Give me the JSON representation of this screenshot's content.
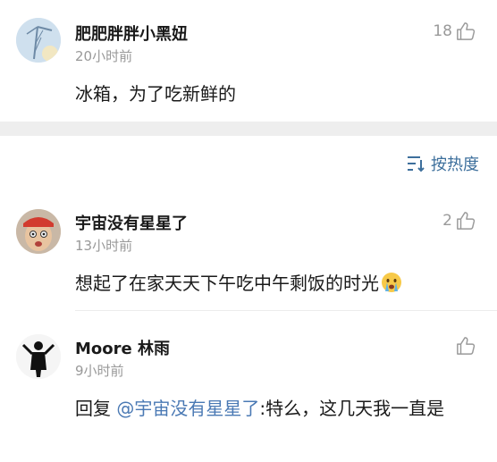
{
  "comments": [
    {
      "username": "肥肥胖胖小黑妞",
      "time": "20小时前",
      "likes": "18",
      "text": "冰箱，为了吃新鲜的"
    },
    {
      "username": "宇宙没有星星了",
      "time": "13小时前",
      "likes": "2",
      "text": "想起了在家天天下午吃中午剩饭的时光"
    },
    {
      "username": "Moore 林雨",
      "time": "9小时前",
      "likes": "",
      "reply_prefix": "回复 ",
      "mention": "@宇宙没有星星了",
      "reply_text": ":特么，这几天我一直是"
    }
  ],
  "sort": {
    "label": "按热度"
  },
  "icons": {
    "like": "thumbs-up-icon",
    "sort": "sort-icon",
    "emoji": "crying-face-emoji"
  },
  "colors": {
    "link": "#4a79b4",
    "sort": "#3d6f9c",
    "muted": "#999999",
    "band": "#eeeeee"
  }
}
